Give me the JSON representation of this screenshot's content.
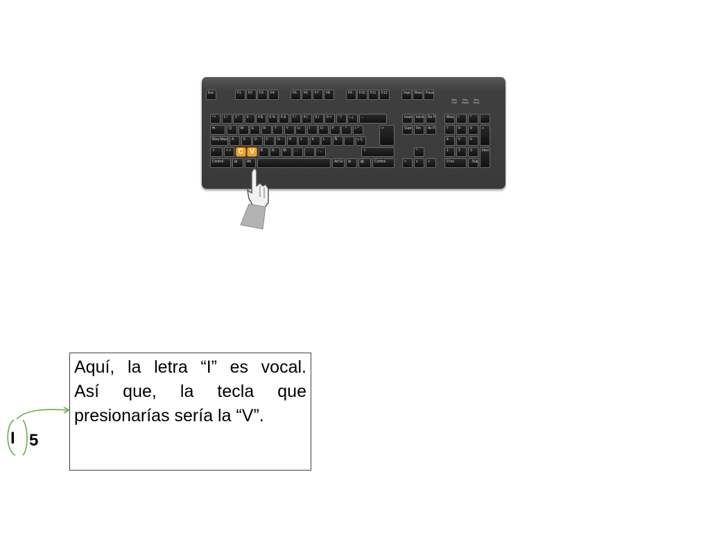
{
  "keyboard": {
    "function_row": [
      "Esc",
      "F1",
      "F2",
      "F3",
      "F4",
      "F5",
      "F6",
      "F7",
      "F8",
      "F9",
      "F10",
      "F11",
      "F12",
      "Impr Pant",
      "Bloq Despl",
      "Pausa Inter"
    ],
    "leds": [
      "Bloq Num",
      "Bloq Mayús",
      "Bloq Despl"
    ],
    "number_row": [
      "º ª",
      "1 !",
      "2 \"",
      "3 ·",
      "4 $",
      "5 %",
      "6 &",
      "7 /",
      "8 (",
      "9 )",
      "0 =",
      "' ?",
      "¡ ¿",
      "←"
    ],
    "qwerty_row": [
      "⇆",
      "Q",
      "W",
      "E",
      "R",
      "T",
      "Y",
      "U",
      "I",
      "O",
      "P",
      "` ^",
      "+ *"
    ],
    "home_row": [
      "Bloq Mayús",
      "A",
      "S",
      "D",
      "F",
      "G",
      "H",
      "J",
      "K",
      "L",
      "Ñ",
      "´ ¨",
      "ç Ç"
    ],
    "bottom_letters": [
      "⇧",
      "< >",
      "C",
      "V",
      "B",
      "N",
      "M",
      ", ;",
      ". :",
      "- _",
      "⇧"
    ],
    "space_row": [
      "Control",
      "⊞",
      "Alt",
      "Alt Gr",
      "⊞",
      "▤",
      "Control"
    ],
    "edit_keys": [
      "Insert",
      "Inicio",
      "Re Pág",
      "Supr",
      "Fin",
      "Av Pág"
    ],
    "arrow_keys": [
      "^",
      "<",
      "v",
      ">"
    ],
    "numpad": [
      "Bloq Num",
      "/",
      "*",
      "-",
      "7",
      "8",
      "9",
      "+",
      "4",
      "5",
      "6",
      "1",
      "2",
      "3",
      "Intro",
      "0 Ins",
      ". Supr"
    ],
    "highlighted": [
      "C",
      "V"
    ],
    "highlight_color": "#f2a32a"
  },
  "explanation": {
    "lines": [
      "Aquí, la letra “I” es vocal.",
      "Así que, la tecla que",
      "presionarías sería la “V”."
    ],
    "letter": "I",
    "number": "5",
    "arrow_color": "#6aa84f"
  }
}
